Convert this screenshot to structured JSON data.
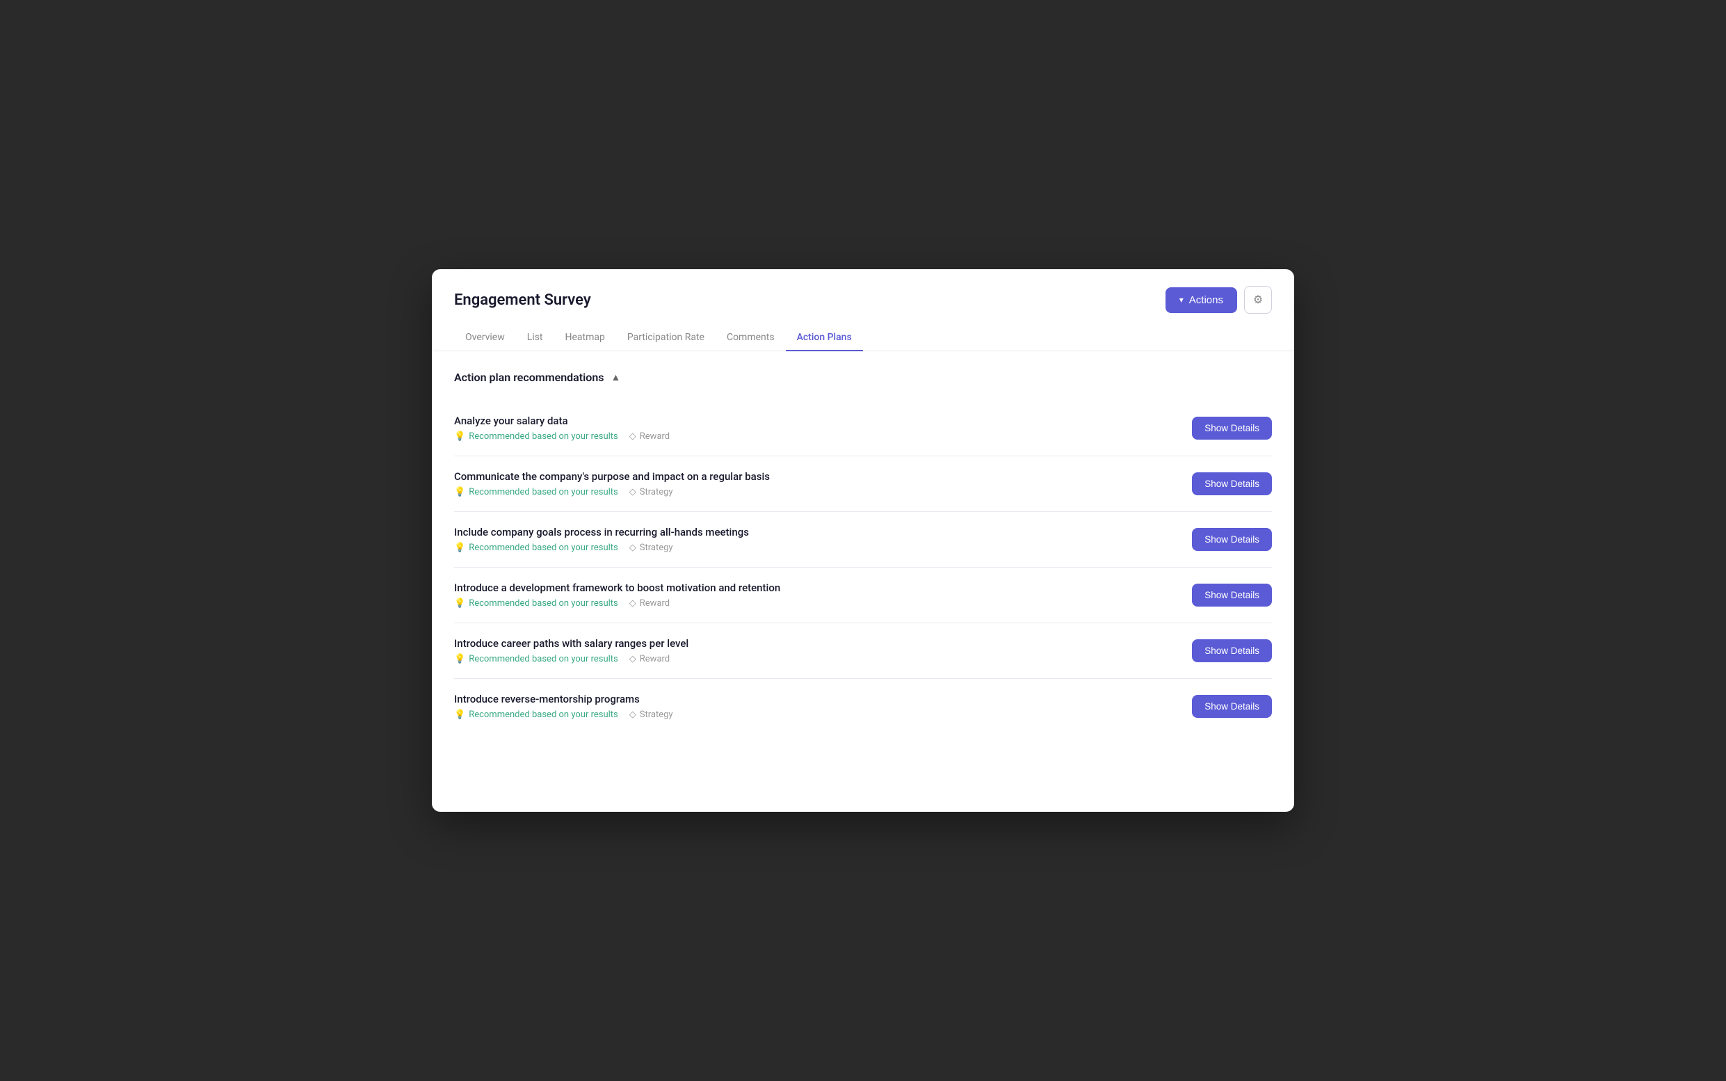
{
  "header": {
    "title": "Engagement Survey",
    "actions_label": "Actions",
    "gear_icon": "⚙"
  },
  "nav": {
    "tabs": [
      {
        "id": "overview",
        "label": "Overview",
        "active": false
      },
      {
        "id": "list",
        "label": "List",
        "active": false
      },
      {
        "id": "heatmap",
        "label": "Heatmap",
        "active": false
      },
      {
        "id": "participation-rate",
        "label": "Participation Rate",
        "active": false
      },
      {
        "id": "comments",
        "label": "Comments",
        "active": false
      },
      {
        "id": "action-plans",
        "label": "Action Plans",
        "active": true
      }
    ]
  },
  "section": {
    "title": "Action plan recommendations",
    "collapse_icon": "▲"
  },
  "action_items": [
    {
      "id": "item-1",
      "title": "Analyze your salary data",
      "recommended_text": "Recommended based on your results",
      "tag": "Reward",
      "show_details_label": "Show Details"
    },
    {
      "id": "item-2",
      "title": "Communicate the company's purpose and impact on a regular basis",
      "recommended_text": "Recommended based on your results",
      "tag": "Strategy",
      "show_details_label": "Show Details"
    },
    {
      "id": "item-3",
      "title": "Include company goals process in recurring all-hands meetings",
      "recommended_text": "Recommended based on your results",
      "tag": "Strategy",
      "show_details_label": "Show Details"
    },
    {
      "id": "item-4",
      "title": "Introduce a development framework to boost motivation and retention",
      "recommended_text": "Recommended based on your results",
      "tag": "Reward",
      "show_details_label": "Show Details"
    },
    {
      "id": "item-5",
      "title": "Introduce career paths with salary ranges per level",
      "recommended_text": "Recommended based on your results",
      "tag": "Reward",
      "show_details_label": "Show Details"
    },
    {
      "id": "item-6",
      "title": "Introduce reverse-mentorship programs",
      "recommended_text": "Recommended based on your results",
      "tag": "Strategy",
      "show_details_label": "Show Details"
    }
  ]
}
